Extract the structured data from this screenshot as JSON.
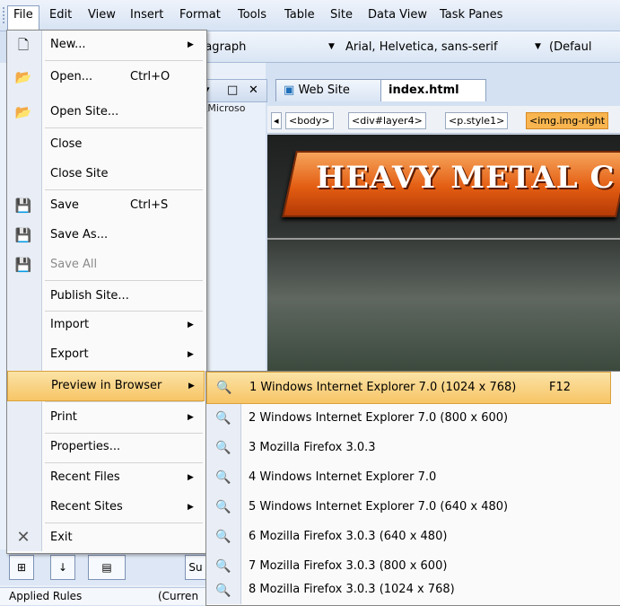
{
  "menubar": {
    "items": [
      "File",
      "Edit",
      "View",
      "Insert",
      "Format",
      "Tools",
      "Table",
      "Site",
      "Data View",
      "Task Panes"
    ]
  },
  "format_toolbar": {
    "style_value": "ragraph",
    "font_value": "Arial, Helvetica, sans-serif",
    "size_value": "(Defaul"
  },
  "left_panel": {
    "path_text": "s\\Microso",
    "sub_button": "Su",
    "applied_rules": "Applied Rules",
    "current": "(Curren"
  },
  "editor": {
    "tabs": [
      "Web Site",
      "index.html"
    ],
    "quick_tags": [
      "<body>",
      "<div#layer4>",
      "<p.style1>",
      "<img.img-right"
    ],
    "banner_text": "HEAVY METAL C"
  },
  "file_menu": {
    "items": [
      {
        "label": "New...",
        "shortcut": "",
        "submenu": true,
        "icon": "new-page-icon"
      },
      {
        "label": "Open...",
        "shortcut": "Ctrl+O",
        "submenu": false,
        "icon": "open-folder-icon"
      },
      {
        "label": "Open Site...",
        "shortcut": "",
        "submenu": false,
        "icon": "open-site-icon"
      },
      {
        "label": "Close",
        "shortcut": "",
        "submenu": false,
        "icon": ""
      },
      {
        "label": "Close Site",
        "shortcut": "",
        "submenu": false,
        "icon": ""
      },
      {
        "label": "Save",
        "shortcut": "Ctrl+S",
        "submenu": false,
        "icon": "save-icon"
      },
      {
        "label": "Save As...",
        "shortcut": "",
        "submenu": false,
        "icon": "save-as-icon"
      },
      {
        "label": "Save All",
        "shortcut": "",
        "submenu": false,
        "icon": "save-all-icon",
        "disabled": true
      },
      {
        "label": "Publish Site...",
        "shortcut": "",
        "submenu": false,
        "icon": ""
      },
      {
        "label": "Import",
        "shortcut": "",
        "submenu": true,
        "icon": ""
      },
      {
        "label": "Export",
        "shortcut": "",
        "submenu": true,
        "icon": ""
      },
      {
        "label": "Preview in Browser",
        "shortcut": "",
        "submenu": true,
        "icon": "",
        "highlighted": true
      },
      {
        "label": "Print",
        "shortcut": "",
        "submenu": true,
        "icon": ""
      },
      {
        "label": "Properties...",
        "shortcut": "",
        "submenu": false,
        "icon": ""
      },
      {
        "label": "Recent Files",
        "shortcut": "",
        "submenu": true,
        "icon": ""
      },
      {
        "label": "Recent Sites",
        "shortcut": "",
        "submenu": true,
        "icon": ""
      },
      {
        "label": "Exit",
        "shortcut": "",
        "submenu": false,
        "icon": "close-x-icon"
      }
    ]
  },
  "preview_submenu": {
    "items": [
      {
        "label": "1 Windows Internet Explorer 7.0 (1024 x 768)",
        "shortcut": "F12",
        "highlighted": true
      },
      {
        "label": "2 Windows Internet Explorer 7.0 (800 x 600)",
        "shortcut": ""
      },
      {
        "label": "3 Mozilla Firefox 3.0.3",
        "shortcut": ""
      },
      {
        "label": "4 Windows Internet Explorer 7.0",
        "shortcut": ""
      },
      {
        "label": "5 Windows Internet Explorer 7.0 (640 x 480)",
        "shortcut": ""
      },
      {
        "label": "6 Mozilla Firefox 3.0.3 (640 x 480)",
        "shortcut": ""
      },
      {
        "label": "7 Mozilla Firefox 3.0.3 (800 x 600)",
        "shortcut": ""
      },
      {
        "label": "8 Mozilla Firefox 3.0.3 (1024 x 768)",
        "shortcut": ""
      }
    ]
  }
}
